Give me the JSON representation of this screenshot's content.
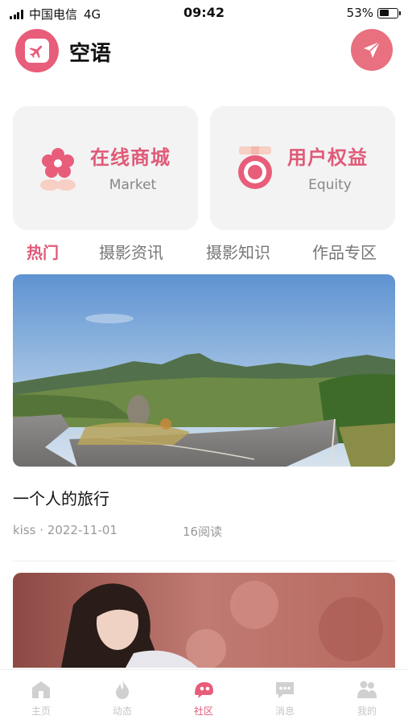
{
  "status_bar": {
    "carrier": "中国电信",
    "network": "4G",
    "time": "09:42",
    "battery": "53%",
    "battery_level": 0.53
  },
  "header": {
    "app_name": "空语",
    "logo_icon": "airplane-icon",
    "action_icon": "paper-plane-icon"
  },
  "cards": [
    {
      "title": "在线商城",
      "subtitle": "Market",
      "icon": "flower-icon"
    },
    {
      "title": "用户权益",
      "subtitle": "Equity",
      "icon": "medal-icon"
    }
  ],
  "tabs": [
    {
      "label": "热门",
      "active": true
    },
    {
      "label": "摄影资讯",
      "active": false
    },
    {
      "label": "摄影知识",
      "active": false
    },
    {
      "label": "作品专区",
      "active": false
    }
  ],
  "posts": [
    {
      "title": "一个人的旅行",
      "author": "kiss",
      "date": "2022-11-01",
      "meta": "kiss · 2022-11-01",
      "reads": "16阅读"
    },
    {
      "title": "",
      "author": "",
      "date": "",
      "meta": "",
      "reads": ""
    }
  ],
  "tabbar": [
    {
      "label": "主页",
      "icon": "home-icon",
      "active": false
    },
    {
      "label": "动态",
      "icon": "flame-icon",
      "active": false
    },
    {
      "label": "社区",
      "icon": "community-icon",
      "active": true
    },
    {
      "label": "消息",
      "icon": "message-icon",
      "active": false
    },
    {
      "label": "我的",
      "icon": "profile-icon",
      "active": false
    }
  ],
  "colors": {
    "accent": "#e05a78",
    "card_bg": "#f3f3f3",
    "inactive": "#c6c6c6"
  }
}
